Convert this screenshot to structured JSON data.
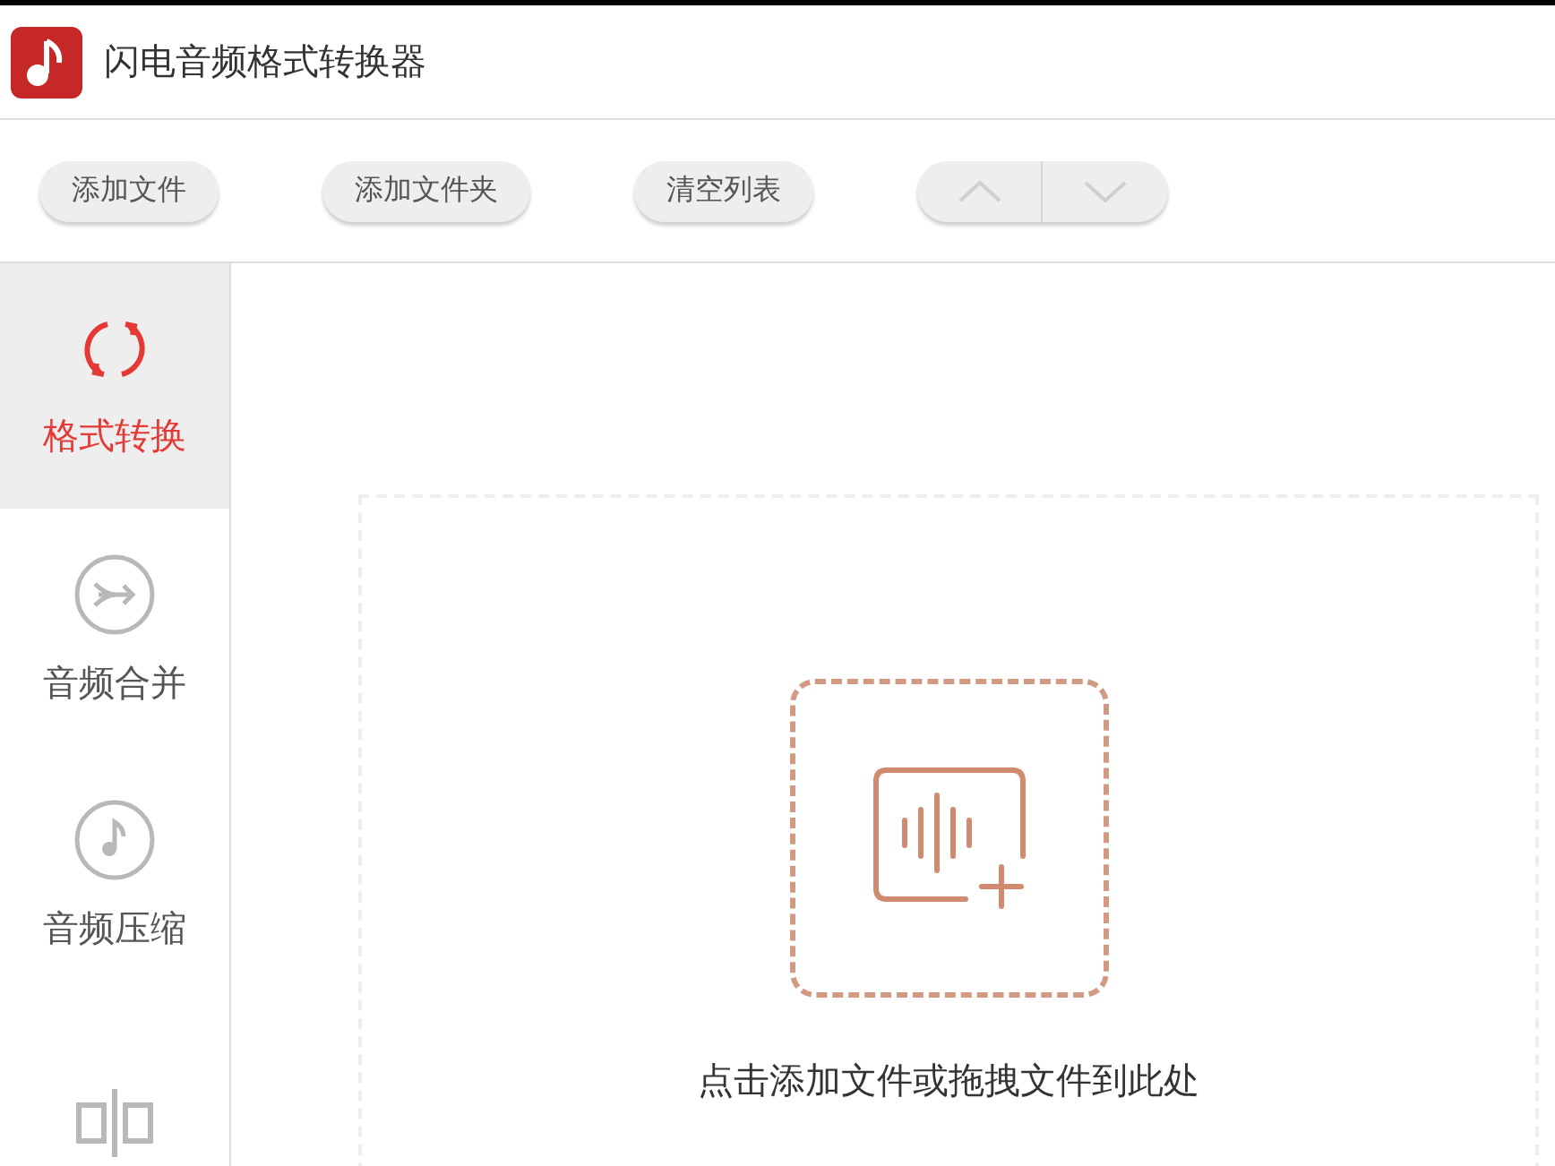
{
  "window": {
    "title": "闪电音频格式转换器"
  },
  "toolbar": {
    "buttons": [
      "添加文件",
      "添加文件夹",
      "清空列表"
    ],
    "move_up": {
      "disabled": true
    },
    "move_down": {
      "disabled": true
    }
  },
  "sidebar": {
    "items": [
      {
        "kind": "convert",
        "label": "格式转换",
        "selected": true
      },
      {
        "kind": "merge",
        "label": "音频合并",
        "selected": false
      },
      {
        "kind": "compress",
        "label": "音频压缩",
        "selected": false
      },
      {
        "kind": "split",
        "selected": false
      }
    ]
  },
  "drop_zone": {
    "hint": "点击添加文件或拖拽文件到此处"
  }
}
